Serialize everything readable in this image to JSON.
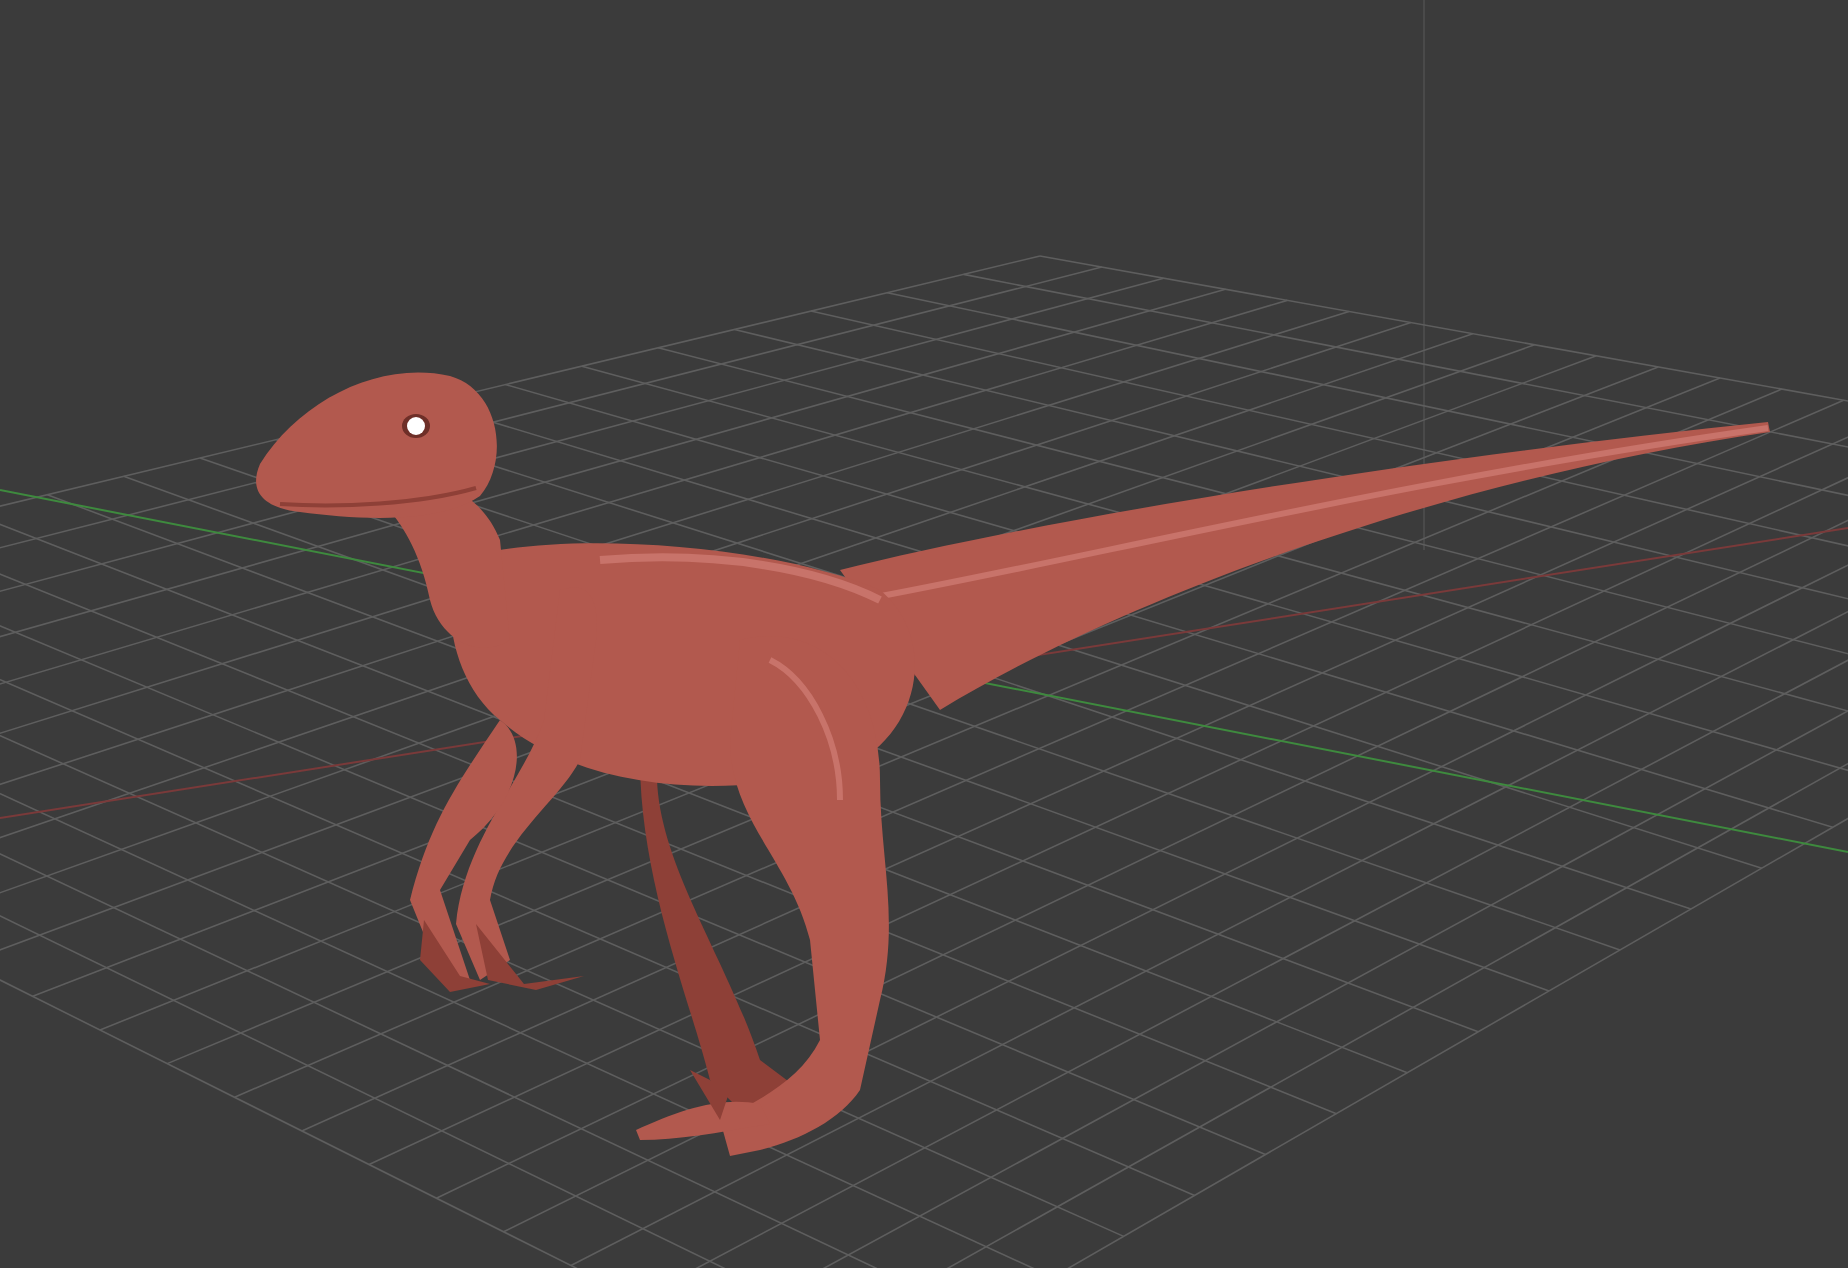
{
  "viewport": {
    "kind": "perspective",
    "grid": true,
    "axes": true
  }
}
